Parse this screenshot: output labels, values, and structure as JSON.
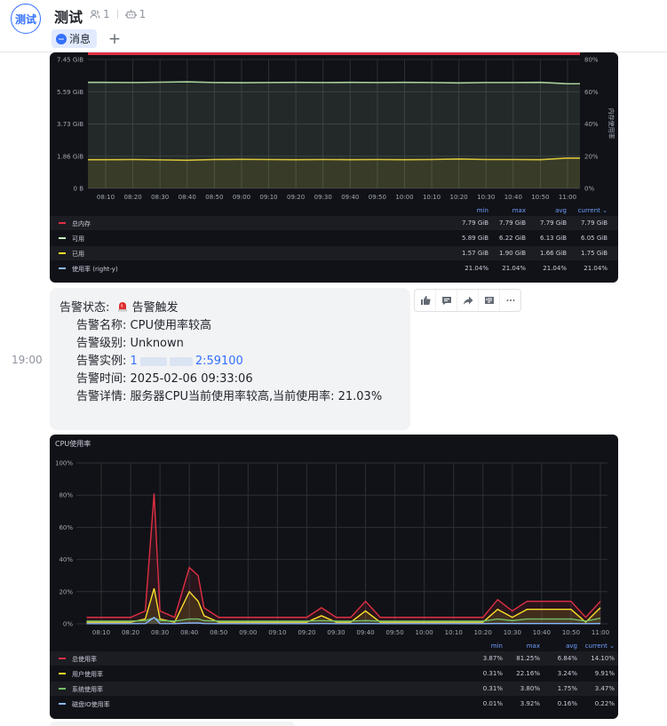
{
  "header": {
    "avatar_text": "测试",
    "title": "测试",
    "member_count": "1",
    "bot_count": "1",
    "tab_label": "消息",
    "add_tab": "+"
  },
  "memory_panel": {
    "y_left_ticks": [
      "7.45 GiB",
      "5.59 GiB",
      "3.73 GiB",
      "1.86 GiB",
      "0 B"
    ],
    "y_right_ticks": [
      "80%",
      "60%",
      "40%",
      "20%",
      "0%"
    ],
    "y_right_label": "内存使用率",
    "x_ticks": [
      "08:10",
      "08:20",
      "08:30",
      "08:40",
      "08:50",
      "09:00",
      "09:10",
      "09:20",
      "09:30",
      "09:40",
      "09:50",
      "10:00",
      "10:10",
      "10:20",
      "10:30",
      "10:40",
      "10:50",
      "11:00"
    ],
    "legend_headers": [
      "min",
      "max",
      "avg",
      "current"
    ],
    "legend": [
      {
        "name": "总内存",
        "color": "#e02f44",
        "min": "7.79 GiB",
        "max": "7.79 GiB",
        "avg": "7.79 GiB",
        "current": "7.79 GiB"
      },
      {
        "name": "可用",
        "color": "#c8f2c2",
        "min": "5.89 GiB",
        "max": "6.22 GiB",
        "avg": "6.13 GiB",
        "current": "6.05 GiB"
      },
      {
        "name": "已用",
        "color": "#fade2a",
        "min": "1.57 GiB",
        "max": "1.90 GiB",
        "avg": "1.66 GiB",
        "current": "1.75 GiB"
      },
      {
        "name": "使用率 (right-y)",
        "color": "#8ab8ff",
        "min": "21.04%",
        "max": "21.04%",
        "avg": "21.04%",
        "current": "21.04%"
      }
    ]
  },
  "alert": {
    "timestamp": "19:00",
    "status_label": "告警状态:",
    "status_value": "告警触发",
    "name_label": "告警名称:",
    "name_value": "CPU使用率较高",
    "level_label": "告警级别:",
    "level_value": "Unknown",
    "instance_label": "告警实例:",
    "instance_start": "1",
    "instance_end": "2:59100",
    "time_label": "告警时间:",
    "time_value": "2025-02-06 09:33:06",
    "detail_label": "告警详情:",
    "detail_value": "服务器CPU当前使用率较高,当前使用率: 21.03%"
  },
  "cpu_panel": {
    "title": "CPU使用率",
    "y_ticks": [
      "100%",
      "80%",
      "60%",
      "40%",
      "20%",
      "0%"
    ],
    "x_ticks": [
      "08:10",
      "08:20",
      "08:30",
      "08:40",
      "08:50",
      "09:00",
      "09:10",
      "09:20",
      "09:30",
      "09:40",
      "09:50",
      "10:00",
      "10:10",
      "10:20",
      "10:30",
      "10:40",
      "10:50",
      "11:00"
    ],
    "legend_headers": [
      "min",
      "max",
      "avg",
      "current"
    ],
    "legend": [
      {
        "name": "总使用率",
        "color": "#e02f44",
        "min": "3.87%",
        "max": "81.25%",
        "avg": "6.84%",
        "current": "14.10%"
      },
      {
        "name": "用户使用率",
        "color": "#fade2a",
        "min": "0.31%",
        "max": "22.16%",
        "avg": "3.24%",
        "current": "9.91%"
      },
      {
        "name": "系统使用率",
        "color": "#73bf69",
        "min": "0.31%",
        "max": "3.80%",
        "avg": "1.75%",
        "current": "3.47%"
      },
      {
        "name": "磁盘IO使用率",
        "color": "#8ab8ff",
        "min": "0.01%",
        "max": "3.92%",
        "avg": "0.16%",
        "current": "0.22%"
      }
    ]
  },
  "chart_data": [
    {
      "type": "line",
      "x": [
        "08:10",
        "08:20",
        "08:30",
        "08:40",
        "08:50",
        "09:00",
        "09:10",
        "09:20",
        "09:30",
        "09:40",
        "09:50",
        "10:00",
        "10:10",
        "10:20",
        "10:30",
        "10:40",
        "10:50",
        "11:00"
      ],
      "ylabel": "",
      "y2label": "内存使用率",
      "ylim": [
        0,
        7.45
      ],
      "y2lim": [
        0,
        80
      ],
      "series": [
        {
          "name": "总内存",
          "values": [
            7.79,
            7.79,
            7.79,
            7.79,
            7.79,
            7.79,
            7.79,
            7.79,
            7.79,
            7.79,
            7.79,
            7.79,
            7.79,
            7.79,
            7.79,
            7.79,
            7.79,
            7.79
          ]
        },
        {
          "name": "可用",
          "values": [
            6.13,
            6.12,
            6.14,
            6.16,
            6.12,
            6.11,
            6.12,
            6.13,
            6.12,
            6.13,
            6.12,
            6.13,
            6.12,
            6.1,
            6.12,
            6.12,
            6.13,
            6.05
          ]
        },
        {
          "name": "已用",
          "values": [
            1.66,
            1.67,
            1.65,
            1.63,
            1.67,
            1.68,
            1.67,
            1.66,
            1.67,
            1.66,
            1.67,
            1.66,
            1.67,
            1.7,
            1.67,
            1.67,
            1.66,
            1.75
          ]
        },
        {
          "name": "使用率 (right-y)",
          "values": [
            21.04,
            21.04,
            21.04,
            21.04,
            21.04,
            21.04,
            21.04,
            21.04,
            21.04,
            21.04,
            21.04,
            21.04,
            21.04,
            21.04,
            21.04,
            21.04,
            21.04,
            21.04
          ]
        }
      ]
    },
    {
      "type": "line",
      "title": "CPU使用率",
      "x": [
        "08:05",
        "08:10",
        "08:15",
        "08:20",
        "08:25",
        "08:28",
        "08:30",
        "08:35",
        "08:40",
        "08:43",
        "08:45",
        "08:50",
        "08:55",
        "09:00",
        "09:05",
        "09:10",
        "09:15",
        "09:20",
        "09:25",
        "09:30",
        "09:35",
        "09:40",
        "09:45",
        "09:50",
        "09:55",
        "10:00",
        "10:05",
        "10:10",
        "10:15",
        "10:20",
        "10:25",
        "10:30",
        "10:35",
        "10:40",
        "10:45",
        "10:50",
        "10:55",
        "11:00"
      ],
      "ylim": [
        0,
        100
      ],
      "series": [
        {
          "name": "总使用率",
          "values": [
            4,
            4,
            4,
            4,
            8,
            81,
            8,
            4,
            35,
            30,
            10,
            4,
            4,
            4,
            4,
            4,
            4,
            4,
            10,
            4,
            4,
            14,
            4,
            4,
            4,
            4,
            4,
            4,
            4,
            4,
            15,
            8,
            14,
            14,
            14,
            14,
            4,
            14
          ]
        },
        {
          "name": "用户使用率",
          "values": [
            1,
            1,
            1,
            1,
            3,
            22,
            3,
            1,
            20,
            14,
            5,
            1,
            1,
            1,
            1,
            1,
            1,
            1,
            5,
            1,
            1,
            8,
            1,
            1,
            1,
            1,
            1,
            1,
            1,
            1,
            9,
            4,
            9,
            9,
            9,
            9,
            1,
            10
          ]
        },
        {
          "name": "系统使用率",
          "values": [
            1.7,
            1.7,
            1.7,
            1.7,
            2,
            3.8,
            2,
            1.7,
            3,
            3,
            2,
            1.7,
            1.7,
            1.7,
            1.7,
            1.7,
            1.7,
            1.7,
            2,
            1.7,
            1.7,
            2,
            1.7,
            1.7,
            1.7,
            1.7,
            1.7,
            1.7,
            1.7,
            1.7,
            3,
            2,
            3,
            3,
            3,
            3,
            1.7,
            3.5
          ]
        },
        {
          "name": "磁盘IO使用率",
          "values": [
            0.1,
            0.1,
            0.1,
            0.1,
            0.2,
            3.9,
            0.2,
            0.1,
            0.5,
            0.5,
            0.2,
            0.1,
            0.1,
            0.1,
            0.1,
            0.1,
            0.1,
            0.1,
            0.2,
            0.1,
            0.1,
            0.2,
            0.1,
            0.1,
            0.1,
            0.1,
            0.1,
            0.1,
            0.1,
            0.1,
            0.2,
            0.2,
            0.2,
            0.2,
            0.2,
            0.2,
            0.1,
            0.2
          ]
        }
      ]
    }
  ]
}
